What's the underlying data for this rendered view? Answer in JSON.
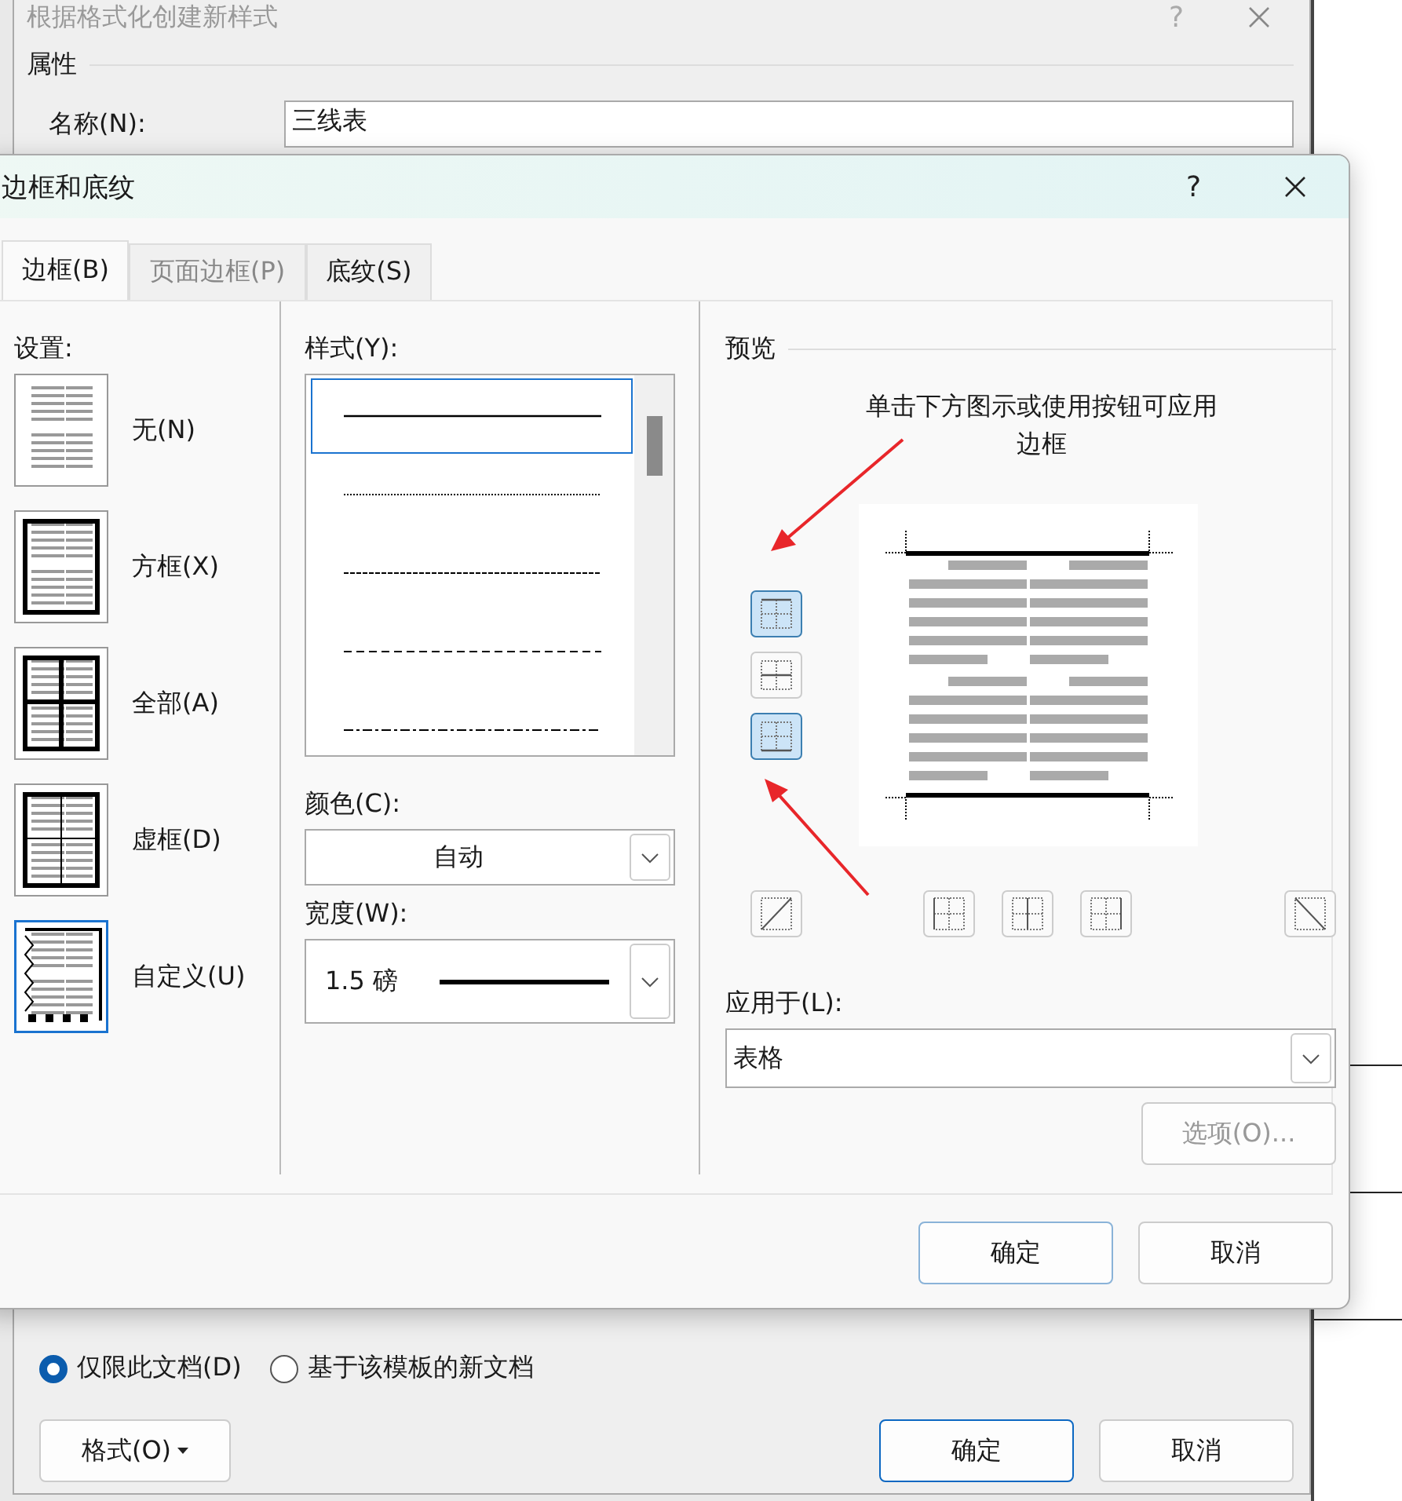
{
  "back_dialog": {
    "title": "根据格式化创建新样式",
    "help": "?",
    "section": "属性",
    "name_label": "名称(N):",
    "name_value": "三线表",
    "save_scope": [
      {
        "label": "仅限此文档(D)",
        "selected": true
      },
      {
        "label": "基于该模板的新文档",
        "selected": false
      }
    ],
    "format_button": "格式(O)",
    "ok": "确定",
    "cancel": "取消"
  },
  "dialog": {
    "title": "边框和底纹",
    "help": "?",
    "tabs": [
      {
        "label": "边框(B)",
        "selected": true,
        "disabled": false
      },
      {
        "label": "页面边框(P)",
        "selected": false,
        "disabled": true
      },
      {
        "label": "底纹(S)",
        "selected": false,
        "disabled": false
      }
    ],
    "settings_label": "设置:",
    "settings": [
      {
        "label": "无(N)",
        "kind": "none",
        "selected": false
      },
      {
        "label": "方框(X)",
        "kind": "box",
        "selected": false
      },
      {
        "label": "全部(A)",
        "kind": "all",
        "selected": false
      },
      {
        "label": "虚框(D)",
        "kind": "grid",
        "selected": false
      },
      {
        "label": "自定义(U)",
        "kind": "custom",
        "selected": true
      }
    ],
    "style_label": "样式(Y):",
    "styles": [
      {
        "kind": "solid",
        "selected": true
      },
      {
        "kind": "dotted",
        "selected": false
      },
      {
        "kind": "fine-dashed",
        "selected": false
      },
      {
        "kind": "dashed",
        "selected": false
      },
      {
        "kind": "dash-dot",
        "selected": false
      }
    ],
    "color_label": "颜色(C):",
    "color_value": "自动",
    "width_label": "宽度(W):",
    "width_value": "1.5 磅",
    "preview_label": "预览",
    "preview_hint": "单击下方图示或使用按钮可应用边框",
    "side_buttons": [
      {
        "kind": "top",
        "selected": true
      },
      {
        "kind": "inside-h",
        "selected": false
      },
      {
        "kind": "bottom",
        "selected": true
      }
    ],
    "bottom_buttons": [
      {
        "kind": "diag-up",
        "selected": false
      },
      {
        "kind": "left",
        "selected": false
      },
      {
        "kind": "inside-v",
        "selected": false
      },
      {
        "kind": "right",
        "selected": false
      },
      {
        "kind": "diag-down",
        "selected": false
      }
    ],
    "apply_label": "应用于(L):",
    "apply_value": "表格",
    "options_button": {
      "label": "选项(O)...",
      "disabled": true
    },
    "ok": "确定",
    "cancel": "取消"
  }
}
